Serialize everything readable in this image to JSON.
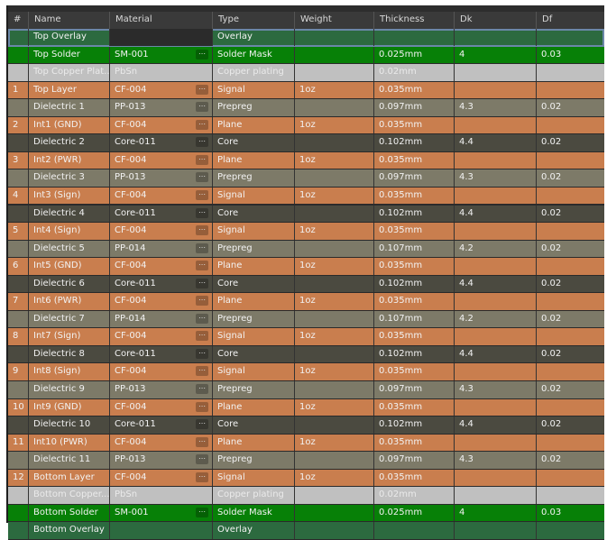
{
  "colors": {
    "overlay": "#2c6a3f",
    "solder": "#078007",
    "plating": "#c0c0c0",
    "copper": "#c97e4e",
    "prepreg": "#7d7a68",
    "core": "#4b4a40"
  },
  "headers": [
    "#",
    "Name",
    "Material",
    "Type",
    "Weight",
    "Thickness",
    "Dk",
    "Df"
  ],
  "rows": [
    {
      "kind": "overlay",
      "num": "",
      "name": "Top Overlay",
      "material": "",
      "type": "Overlay",
      "weight": "",
      "thickness": "",
      "dk": "",
      "df": ""
    },
    {
      "kind": "solder",
      "num": "",
      "name": "Top Solder",
      "material": "SM-001",
      "type": "Solder Mask",
      "weight": "",
      "thickness": "0.025mm",
      "dk": "4",
      "df": "0.03"
    },
    {
      "kind": "plating",
      "num": "",
      "name": "Top Copper Plat...",
      "material": "PbSn",
      "type": "Copper plating",
      "weight": "",
      "thickness": "0.02mm",
      "dk": "",
      "df": ""
    },
    {
      "kind": "copper",
      "num": "1",
      "name": "Top Layer",
      "material": "CF-004",
      "type": "Signal",
      "weight": "1oz",
      "thickness": "0.035mm",
      "dk": "",
      "df": ""
    },
    {
      "kind": "prepreg",
      "num": "",
      "name": "Dielectric 1",
      "material": "PP-013",
      "type": "Prepreg",
      "weight": "",
      "thickness": "0.097mm",
      "dk": "4.3",
      "df": "0.02"
    },
    {
      "kind": "copper",
      "num": "2",
      "name": "Int1 (GND)",
      "material": "CF-004",
      "type": "Plane",
      "weight": "1oz",
      "thickness": "0.035mm",
      "dk": "",
      "df": ""
    },
    {
      "kind": "core",
      "num": "",
      "name": "Dielectric 2",
      "material": "Core-011",
      "type": "Core",
      "weight": "",
      "thickness": "0.102mm",
      "dk": "4.4",
      "df": "0.02"
    },
    {
      "kind": "copper",
      "num": "3",
      "name": "Int2 (PWR)",
      "material": "CF-004",
      "type": "Plane",
      "weight": "1oz",
      "thickness": "0.035mm",
      "dk": "",
      "df": ""
    },
    {
      "kind": "prepreg",
      "num": "",
      "name": "Dielectric 3",
      "material": "PP-013",
      "type": "Prepreg",
      "weight": "",
      "thickness": "0.097mm",
      "dk": "4.3",
      "df": "0.02"
    },
    {
      "kind": "copper",
      "num": "4",
      "name": "Int3 (Sign)",
      "material": "CF-004",
      "type": "Signal",
      "weight": "1oz",
      "thickness": "0.035mm",
      "dk": "",
      "df": ""
    },
    {
      "kind": "core",
      "num": "",
      "name": "Dielectric 4",
      "material": "Core-011",
      "type": "Core",
      "weight": "",
      "thickness": "0.102mm",
      "dk": "4.4",
      "df": "0.02"
    },
    {
      "kind": "copper",
      "num": "5",
      "name": "Int4 (Sign)",
      "material": "CF-004",
      "type": "Signal",
      "weight": "1oz",
      "thickness": "0.035mm",
      "dk": "",
      "df": ""
    },
    {
      "kind": "prepreg",
      "num": "",
      "name": "Dielectric 5",
      "material": "PP-014",
      "type": "Prepreg",
      "weight": "",
      "thickness": "0.107mm",
      "dk": "4.2",
      "df": "0.02"
    },
    {
      "kind": "copper",
      "num": "6",
      "name": "Int5 (GND)",
      "material": "CF-004",
      "type": "Plane",
      "weight": "1oz",
      "thickness": "0.035mm",
      "dk": "",
      "df": ""
    },
    {
      "kind": "core",
      "num": "",
      "name": "Dielectric 6",
      "material": "Core-011",
      "type": "Core",
      "weight": "",
      "thickness": "0.102mm",
      "dk": "4.4",
      "df": "0.02"
    },
    {
      "kind": "copper",
      "num": "7",
      "name": "Int6 (PWR)",
      "material": "CF-004",
      "type": "Plane",
      "weight": "1oz",
      "thickness": "0.035mm",
      "dk": "",
      "df": ""
    },
    {
      "kind": "prepreg",
      "num": "",
      "name": "Dielectric 7",
      "material": "PP-014",
      "type": "Prepreg",
      "weight": "",
      "thickness": "0.107mm",
      "dk": "4.2",
      "df": "0.02"
    },
    {
      "kind": "copper",
      "num": "8",
      "name": "Int7 (Sign)",
      "material": "CF-004",
      "type": "Signal",
      "weight": "1oz",
      "thickness": "0.035mm",
      "dk": "",
      "df": ""
    },
    {
      "kind": "core",
      "num": "",
      "name": "Dielectric 8",
      "material": "Core-011",
      "type": "Core",
      "weight": "",
      "thickness": "0.102mm",
      "dk": "4.4",
      "df": "0.02"
    },
    {
      "kind": "copper",
      "num": "9",
      "name": "Int8 (Sign)",
      "material": "CF-004",
      "type": "Signal",
      "weight": "1oz",
      "thickness": "0.035mm",
      "dk": "",
      "df": ""
    },
    {
      "kind": "prepreg",
      "num": "",
      "name": "Dielectric 9",
      "material": "PP-013",
      "type": "Prepreg",
      "weight": "",
      "thickness": "0.097mm",
      "dk": "4.3",
      "df": "0.02"
    },
    {
      "kind": "copper",
      "num": "10",
      "name": "Int9 (GND)",
      "material": "CF-004",
      "type": "Plane",
      "weight": "1oz",
      "thickness": "0.035mm",
      "dk": "",
      "df": ""
    },
    {
      "kind": "core",
      "num": "",
      "name": "Dielectric 10",
      "material": "Core-011",
      "type": "Core",
      "weight": "",
      "thickness": "0.102mm",
      "dk": "4.4",
      "df": "0.02"
    },
    {
      "kind": "copper",
      "num": "11",
      "name": "Int10 (PWR)",
      "material": "CF-004",
      "type": "Plane",
      "weight": "1oz",
      "thickness": "0.035mm",
      "dk": "",
      "df": ""
    },
    {
      "kind": "prepreg",
      "num": "",
      "name": "Dielectric 11",
      "material": "PP-013",
      "type": "Prepreg",
      "weight": "",
      "thickness": "0.097mm",
      "dk": "4.3",
      "df": "0.02"
    },
    {
      "kind": "copper",
      "num": "12",
      "name": "Bottom Layer",
      "material": "CF-004",
      "type": "Signal",
      "weight": "1oz",
      "thickness": "0.035mm",
      "dk": "",
      "df": ""
    },
    {
      "kind": "plating",
      "num": "",
      "name": "Bottom Copper...",
      "material": "PbSn",
      "type": "Copper plating",
      "weight": "",
      "thickness": "0.02mm",
      "dk": "",
      "df": ""
    },
    {
      "kind": "solder",
      "num": "",
      "name": "Bottom Solder",
      "material": "SM-001",
      "type": "Solder Mask",
      "weight": "",
      "thickness": "0.025mm",
      "dk": "4",
      "df": "0.03"
    },
    {
      "kind": "overlay",
      "num": "",
      "name": "Bottom Overlay",
      "material": "",
      "type": "Overlay",
      "weight": "",
      "thickness": "",
      "dk": "",
      "df": ""
    }
  ]
}
